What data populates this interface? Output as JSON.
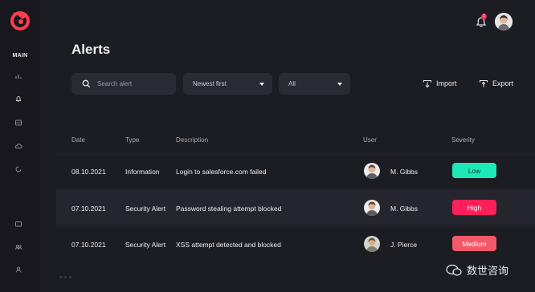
{
  "sidebar": {
    "section_label": "MAIN",
    "icons": [
      "chart-icon",
      "bell-icon",
      "grid-icon",
      "cloud-icon",
      "refresh-icon",
      "folder-icon",
      "users-icon",
      "user-icon"
    ]
  },
  "header": {
    "title": "Alerts",
    "notification_count": "1"
  },
  "toolbar": {
    "search_placeholder": "Search alert",
    "sort_value": "Newest first",
    "filter_value": "All",
    "import_label": "Import",
    "export_label": "Export"
  },
  "table": {
    "columns": {
      "date": "Date",
      "type": "Type",
      "description": "Description",
      "user": "User",
      "severity": "Severity"
    },
    "rows": [
      {
        "date": "08.10.2021",
        "type": "Information",
        "description": "Login to salesforce.com failed",
        "user": "M. Gibbs",
        "severity": "Low"
      },
      {
        "date": "07.10.2021",
        "type": "Security Alert",
        "description": "Password stealing attempt blocked",
        "user": "M. Gibbs",
        "severity": "High"
      },
      {
        "date": "07.10.2021",
        "type": "Security Alert",
        "description": "XSS attempt detected and blocked",
        "user": "J. Pierce",
        "severity": "Medium"
      }
    ]
  },
  "colors": {
    "low": "#1de9b6",
    "high": "#ff1f5a",
    "medium": "#f2596a",
    "accent": "#ff2d55"
  },
  "watermark": "数世咨询"
}
